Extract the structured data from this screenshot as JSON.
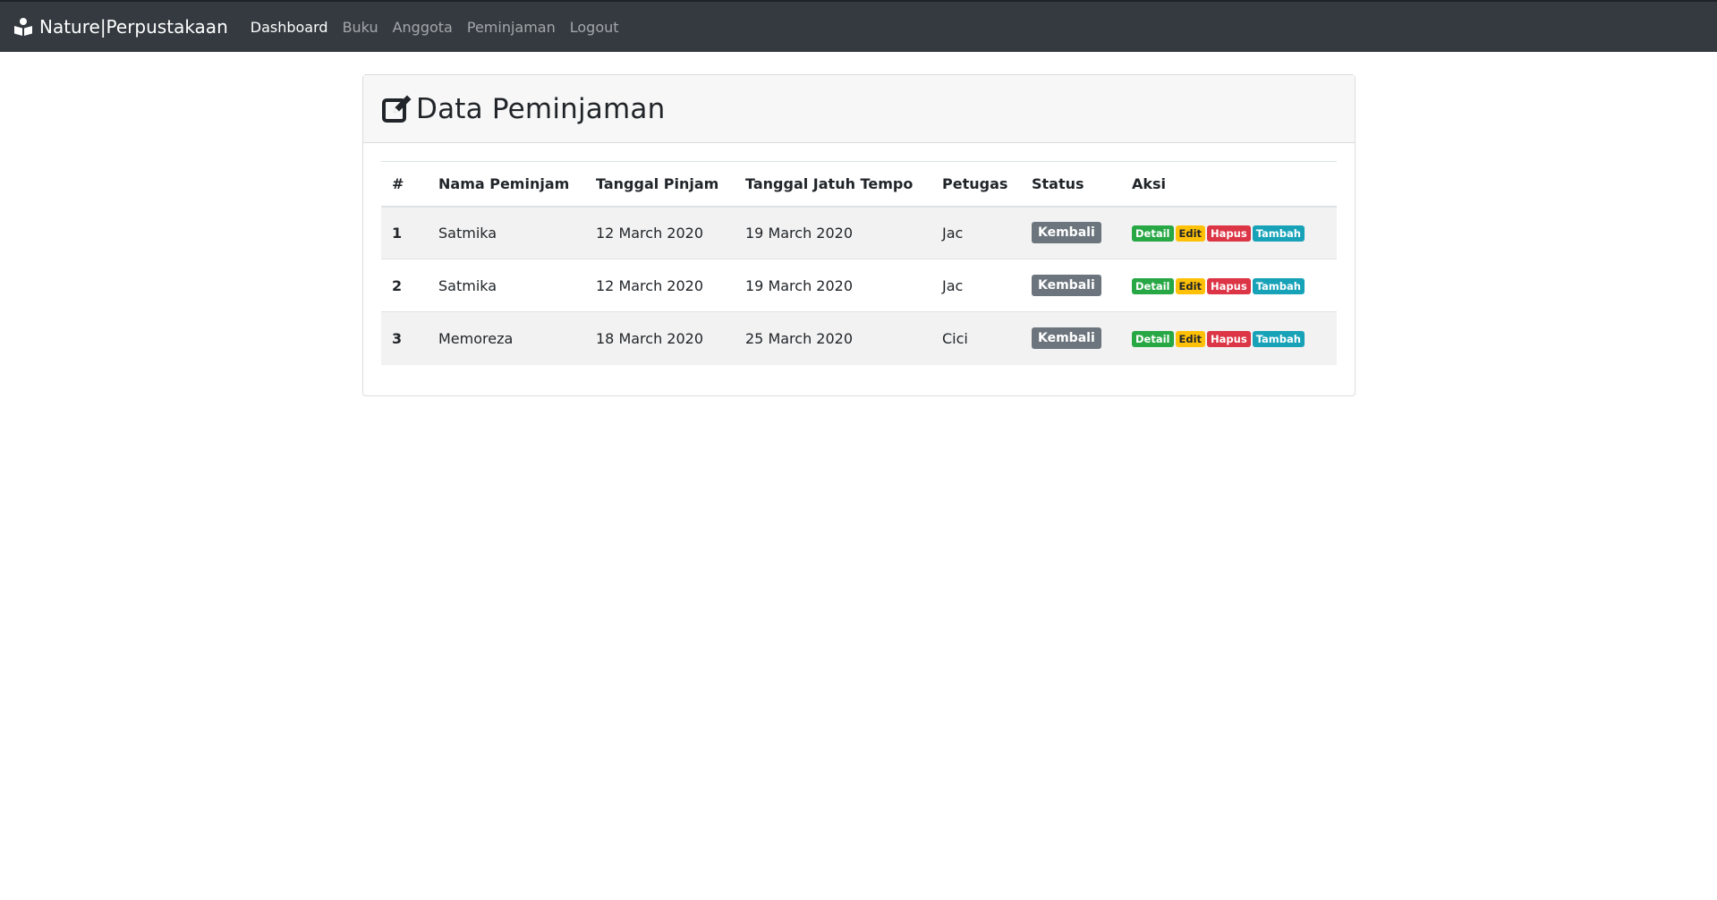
{
  "navbar": {
    "brand": "Nature|Perpustakaan",
    "links": [
      "Dashboard",
      "Buku",
      "Anggota",
      "Peminjaman",
      "Logout"
    ],
    "active": "Dashboard"
  },
  "page": {
    "title": "Data Peminjaman"
  },
  "table": {
    "headers": [
      "#",
      "Nama Peminjam",
      "Tanggal Pinjam",
      "Tanggal Jatuh Tempo",
      "Petugas",
      "Status",
      "Aksi"
    ],
    "rows": [
      {
        "no": "1",
        "nama": "Satmika",
        "pinjam": "12 March 2020",
        "tempo": "19 March 2020",
        "petugas": "Jac",
        "status": "Kembali"
      },
      {
        "no": "2",
        "nama": "Satmika",
        "pinjam": "12 March 2020",
        "tempo": "19 March 2020",
        "petugas": "Jac",
        "status": "Kembali"
      },
      {
        "no": "3",
        "nama": "Memoreza",
        "pinjam": "18 March 2020",
        "tempo": "25 March 2020",
        "petugas": "Cici",
        "status": "Kembali"
      }
    ],
    "actions": {
      "detail": "Detail",
      "edit": "Edit",
      "hapus": "Hapus",
      "tambah": "Tambah"
    }
  },
  "colors": {
    "navbar_bg": "#343a40",
    "status_badge": "#6c757d",
    "detail": "#28a745",
    "edit": "#ffc107",
    "hapus": "#dc3545",
    "tambah": "#17a2b8"
  },
  "icons": {
    "brand": "book-reader-icon",
    "title": "edit-icon"
  }
}
